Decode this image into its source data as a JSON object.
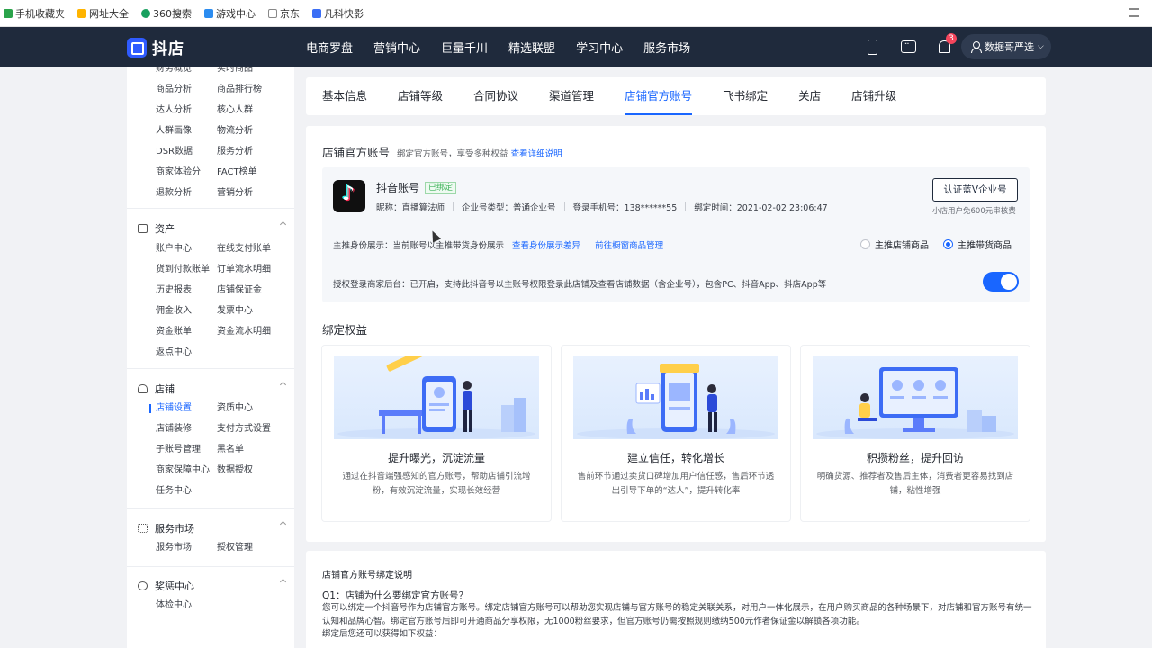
{
  "bookmarks": [
    {
      "label": "手机收藏夹",
      "color": "#2aa34a"
    },
    {
      "label": "网址大全",
      "color": "#ffb400"
    },
    {
      "label": "360搜索",
      "color": "#18a05e"
    },
    {
      "label": "游戏中心",
      "color": "#2b8cf0"
    },
    {
      "label": "京东",
      "color": "#888888"
    },
    {
      "label": "凡科快影",
      "color": "#3b6ef5"
    }
  ],
  "app": {
    "logo_text": "抖店"
  },
  "nav": {
    "items": [
      "电商罗盘",
      "营销中心",
      "巨量千川",
      "精选联盟",
      "学习中心",
      "服务市场"
    ],
    "notification_count": "3",
    "user_label": "数据哥严选"
  },
  "sidebar": {
    "shop_top_rows": [
      [
        "财务概览",
        "实时商品"
      ],
      [
        "商品分析",
        "商品排行榜"
      ],
      [
        "达人分析",
        "核心人群"
      ],
      [
        "人群画像",
        "物流分析"
      ],
      [
        "DSR数据",
        "服务分析"
      ],
      [
        "商家体验分",
        "FACT榜单"
      ],
      [
        "退款分析",
        "营销分析"
      ]
    ],
    "assets": {
      "title": "资产",
      "items": [
        [
          "账户中心",
          "在线支付账单"
        ],
        [
          "货到付款账单",
          "订单流水明细"
        ],
        [
          "历史报表",
          "店铺保证金"
        ],
        [
          "佣金收入",
          "发票中心"
        ],
        [
          "资金账单",
          "资金流水明细"
        ],
        [
          "返点中心",
          ""
        ]
      ]
    },
    "shop": {
      "title": "店铺",
      "items": [
        [
          "店铺设置",
          "资质中心"
        ],
        [
          "店铺装修",
          "支付方式设置"
        ],
        [
          "子账号管理",
          "黑名单"
        ],
        [
          "商家保障中心",
          "数据授权"
        ],
        [
          "任务中心",
          ""
        ]
      ]
    },
    "market": {
      "title": "服务市场",
      "items": [
        [
          "服务市场",
          "授权管理"
        ]
      ]
    },
    "rewards": {
      "title": "奖惩中心",
      "items": [
        [
          "体检中心",
          ""
        ]
      ]
    }
  },
  "tabs": [
    "基本信息",
    "店铺等级",
    "合同协议",
    "渠道管理",
    "店铺官方账号",
    "飞书绑定",
    "关店",
    "店铺升级"
  ],
  "active_tab": "店铺官方账号",
  "official": {
    "title": "店铺官方账号",
    "subtitle": "绑定官方账号，享受多种权益",
    "detail_link": "查看详细说明",
    "account_name": "抖音账号",
    "bound_tag": "已绑定",
    "nickname": "昵称：直播算法师",
    "account_type": "企业号类型：普通企业号",
    "phone": "登录手机号：138******55",
    "bind_time": "绑定时间：2021-02-02 23:06:47",
    "cert_button": "认证蓝V企业号",
    "cert_note": "小店用户免600元审核费",
    "mode_text": "主推身份展示：当前账号以主推带货身份展示",
    "mode_link1": "查看身份展示差异",
    "mode_link2": "前往橱窗商品管理",
    "radio1": "主推店铺商品",
    "radio2": "主推带货商品",
    "auth_text": "授权登录商家后台：已开启，支持此抖音号以主账号权限登录此店铺及查看店铺数据（含企业号），包含PC、抖音App、抖店App等"
  },
  "rights": {
    "title": "绑定权益",
    "cards": [
      {
        "title": "提升曝光，沉淀流量",
        "desc": "通过在抖音端强感知的官方账号，帮助店铺引流增粉，有效沉淀流量，实现长效经营"
      },
      {
        "title": "建立信任，转化增长",
        "desc": "售前环节通过卖货口碑增加用户信任感，售后环节透出引导下单的“达人”，提升转化率"
      },
      {
        "title": "积攒粉丝，提升回访",
        "desc": "明确货源、推荐者及售后主体，消费者更容易找到店铺，粘性增强"
      }
    ]
  },
  "faq": {
    "title": "店铺官方账号绑定说明",
    "q1": "Q1：店铺为什么要绑定官方账号？",
    "a1": "您可以绑定一个抖音号作为店铺官方账号。绑定店铺官方账号可以帮助您实现店铺与官方账号的稳定关联关系，对用户一体化展示，在用户购买商品的各种场景下，对店铺和官方账号有统一认知和品牌心智。绑定官方账号后即可开通商品分享权限，无1000粉丝要求，但官方账号仍需按照规则缴纳500元作者保证金以解锁各项功能。",
    "a1b": "绑定后您还可以获得如下权益："
  }
}
